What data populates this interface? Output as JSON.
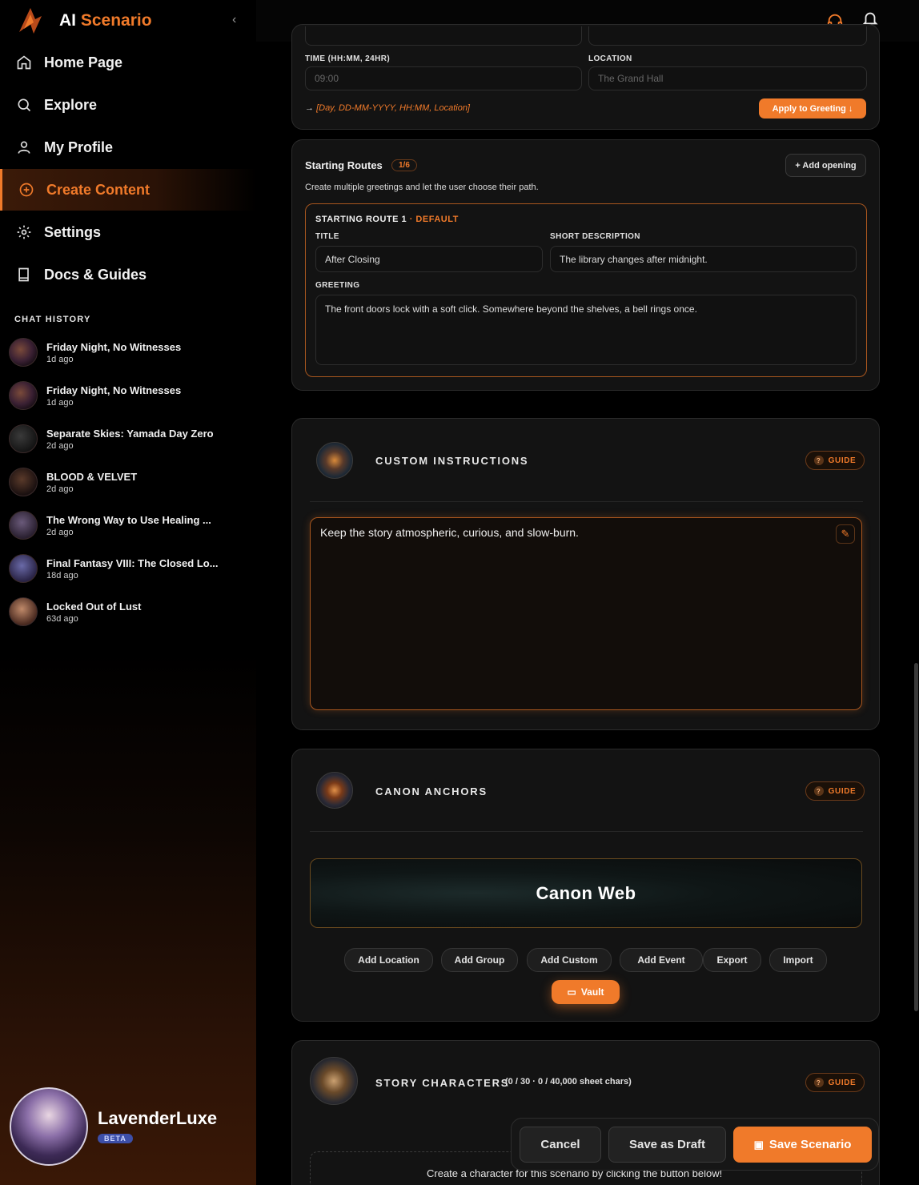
{
  "brand": {
    "name_prefix": "AI",
    "name_accent": "Scenario",
    "collapse": "‹"
  },
  "nav": [
    {
      "label": "Home Page",
      "icon": "home-icon"
    },
    {
      "label": "Explore",
      "icon": "search-icon"
    },
    {
      "label": "My Profile",
      "icon": "user-icon"
    },
    {
      "label": "Create Content",
      "icon": "plus-circle-icon",
      "active": true
    },
    {
      "label": "Settings",
      "icon": "gear-icon"
    },
    {
      "label": "Docs & Guides",
      "icon": "book-icon"
    }
  ],
  "chat_history": {
    "label": "CHAT HISTORY",
    "items": [
      {
        "title": "Friday Night, No Witnesses",
        "time": "1d ago"
      },
      {
        "title": "Friday Night, No Witnesses",
        "time": "1d ago"
      },
      {
        "title": "Separate Skies: Yamada Day Zero",
        "time": "2d ago"
      },
      {
        "title": "BLOOD & VELVET",
        "time": "2d ago"
      },
      {
        "title": "The Wrong Way to Use Healing ...",
        "time": "2d ago"
      },
      {
        "title": "Final Fantasy VIII: The Closed Lo...",
        "time": "18d ago"
      },
      {
        "title": "Locked Out of Lust",
        "time": "63d ago"
      }
    ]
  },
  "user": {
    "name": "LavenderLuxe",
    "badge": "BETA"
  },
  "time_location": {
    "time_label": "TIME (HH:MM, 24HR)",
    "time_placeholder": "09:00",
    "location_label": "LOCATION",
    "location_placeholder": "The Grand Hall",
    "format_hint_arrow": "→",
    "format_hint": "[Day, DD-MM-YYYY, HH:MM, Location]",
    "apply_button": "Apply to Greeting ↓"
  },
  "starting_routes": {
    "title": "Starting Routes",
    "count": "1/6",
    "subtitle": "Create multiple greetings and let the user choose their path.",
    "add_button": "+ Add opening",
    "route": {
      "heading": "STARTING ROUTE 1",
      "default_tag": "· DEFAULT",
      "title_label": "TITLE",
      "title_value": "After Closing",
      "desc_label": "SHORT DESCRIPTION",
      "desc_value": "The library changes after midnight.",
      "greeting_label": "GREETING",
      "greeting_value": "The front doors lock with a soft click. Somewhere beyond the shelves, a bell rings once."
    }
  },
  "custom_instructions": {
    "title": "CUSTOM INSTRUCTIONS",
    "guide": "GUIDE",
    "text": "Keep the story atmospheric, curious, and slow-burn."
  },
  "canon_anchors": {
    "title": "CANON ANCHORS",
    "guide": "GUIDE",
    "banner": "Canon Web",
    "actions": [
      "Add Location",
      "Add Group",
      "Add Custom",
      "Add Event",
      "Export",
      "Import"
    ],
    "vault": "Vault"
  },
  "story_characters": {
    "title": "STORY CHARACTERS",
    "counts": "(0 / 30 · 0 / 40,000 sheet chars)",
    "guide": "GUIDE",
    "hint": "Create a character for this scenario by clicking the button below!"
  },
  "footer_actions": {
    "cancel": "Cancel",
    "draft": "Save as Draft",
    "save": "Save Scenario"
  },
  "colors": {
    "accent": "#f07a2a",
    "panel": "#131313",
    "background": "#000000"
  }
}
